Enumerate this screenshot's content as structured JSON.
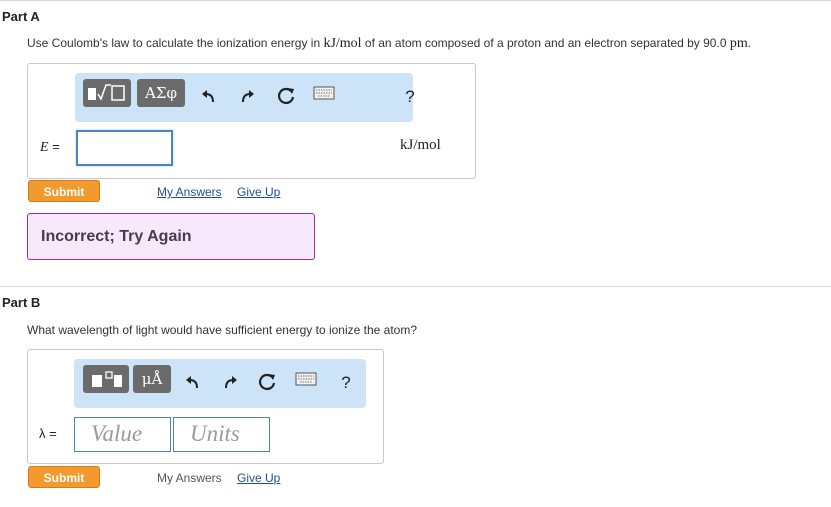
{
  "part_a": {
    "title": "Part A",
    "prompt_pre": "Use Coulomb's law to calculate the ionization energy in ",
    "prompt_unit": "kJ/mol",
    "prompt_mid": " of an atom composed of a proton and an electron separated by 90.0 ",
    "prompt_unit2": "pm",
    "prompt_end": ".",
    "toolbar": {
      "templates_label": "▮√□",
      "greek_label": "ΑΣφ",
      "help_label": "?"
    },
    "variable": "E",
    "equals": "=",
    "unit": "kJ/mol",
    "submit_label": "Submit",
    "my_answers_label": "My Answers",
    "give_up_label": "Give Up",
    "feedback": "Incorrect; Try Again"
  },
  "part_b": {
    "title": "Part B",
    "prompt": "What wavelength of light would have sufficient energy to ionize the atom?",
    "toolbar": {
      "templates_label": "▮▫",
      "units_label": "μÅ",
      "help_label": "?"
    },
    "variable": "λ",
    "equals": "=",
    "value_placeholder": "Value",
    "units_placeholder": "Units",
    "submit_label": "Submit",
    "my_answers_label": "My Answers",
    "give_up_label": "Give Up"
  },
  "colors": {
    "submit": "#f39a2e",
    "toolbar": "#cde3f7",
    "link": "#1f4e9c",
    "feedback_border": "#9b2f9b"
  }
}
